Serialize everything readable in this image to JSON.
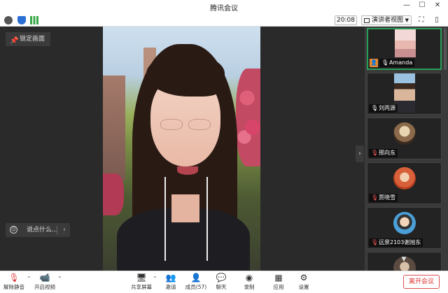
{
  "window": {
    "title": "腾讯会议"
  },
  "topbar": {
    "timer": "20:08",
    "view_label": "演讲者视图"
  },
  "stage": {
    "lock_label": "锁定画面",
    "chat_placeholder": "说点什么..."
  },
  "participants": [
    {
      "name": "Amanda",
      "mic": "on",
      "host": true,
      "active": true
    },
    {
      "name": "刘丙源",
      "mic": "on",
      "host": false,
      "active": false
    },
    {
      "name": "邢向东",
      "mic": "muted",
      "host": false,
      "active": false
    },
    {
      "name": "贾晓雪",
      "mic": "muted",
      "host": false,
      "active": false
    },
    {
      "name": "远景2103谢旭东",
      "mic": "muted",
      "host": false,
      "active": false
    }
  ],
  "toolbar": {
    "unmute": "解除静音",
    "start_video": "开启视频",
    "share_screen": "共享屏幕",
    "invite": "邀请",
    "members": "成员(57)",
    "chat": "聊天",
    "record": "录制",
    "apps": "应用",
    "settings": "设置",
    "leave": "离开会议"
  },
  "colors": {
    "active_border": "#2a9d5a",
    "leave": "#e03030",
    "host_badge": "#e88a2a"
  }
}
